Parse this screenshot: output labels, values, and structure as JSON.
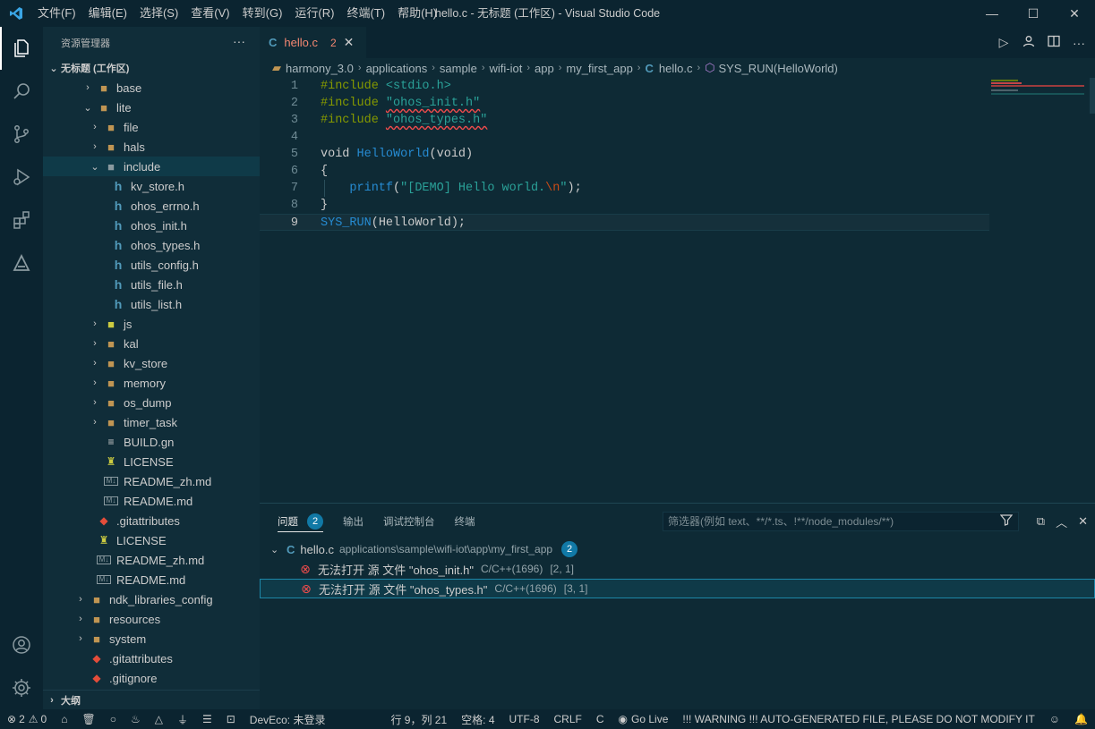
{
  "titlebar": {
    "menu": [
      "文件(F)",
      "编辑(E)",
      "选择(S)",
      "查看(V)",
      "转到(G)",
      "运行(R)",
      "终端(T)",
      "帮助(H)"
    ],
    "title": "hello.c - 无标题 (工作区) - Visual Studio Code",
    "minimize": "—",
    "maximize": "☐",
    "close": "✕"
  },
  "sidebar": {
    "title": "资源管理器",
    "more": "···",
    "workspace": "无标题 (工作区)",
    "outline": "大纲",
    "tree": [
      {
        "label": "base",
        "level": 1,
        "chev": "›",
        "icon": "folder-icon",
        "color": "#c09553"
      },
      {
        "label": "lite",
        "level": 1,
        "chev": "⌄",
        "icon": "folder-open-icon",
        "color": "#c09553"
      },
      {
        "label": "file",
        "level": 2,
        "chev": "›",
        "icon": "folder-icon",
        "color": "#c09553"
      },
      {
        "label": "hals",
        "level": 2,
        "chev": "›",
        "icon": "folder-icon",
        "color": "#c09553"
      },
      {
        "label": "include",
        "level": 2,
        "chev": "⌄",
        "icon": "folder-include-icon",
        "color": "#8a9aa0",
        "selected": true
      },
      {
        "label": "kv_store.h",
        "level": 3,
        "chev": "",
        "icon": "h-file-icon",
        "color": "#519aba"
      },
      {
        "label": "ohos_errno.h",
        "level": 3,
        "chev": "",
        "icon": "h-file-icon",
        "color": "#519aba"
      },
      {
        "label": "ohos_init.h",
        "level": 3,
        "chev": "",
        "icon": "h-file-icon",
        "color": "#519aba"
      },
      {
        "label": "ohos_types.h",
        "level": 3,
        "chev": "",
        "icon": "h-file-icon",
        "color": "#519aba"
      },
      {
        "label": "utils_config.h",
        "level": 3,
        "chev": "",
        "icon": "h-file-icon",
        "color": "#519aba"
      },
      {
        "label": "utils_file.h",
        "level": 3,
        "chev": "",
        "icon": "h-file-icon",
        "color": "#519aba"
      },
      {
        "label": "utils_list.h",
        "level": 3,
        "chev": "",
        "icon": "h-file-icon",
        "color": "#519aba"
      },
      {
        "label": "js",
        "level": 2,
        "chev": "›",
        "icon": "folder-js-icon",
        "color": "#cbcb41"
      },
      {
        "label": "kal",
        "level": 2,
        "chev": "›",
        "icon": "folder-icon",
        "color": "#c09553"
      },
      {
        "label": "kv_store",
        "level": 2,
        "chev": "›",
        "icon": "folder-icon",
        "color": "#c09553"
      },
      {
        "label": "memory",
        "level": 2,
        "chev": "›",
        "icon": "folder-icon",
        "color": "#c09553"
      },
      {
        "label": "os_dump",
        "level": 2,
        "chev": "›",
        "icon": "folder-icon",
        "color": "#c09553"
      },
      {
        "label": "timer_task",
        "level": 2,
        "chev": "›",
        "icon": "folder-icon",
        "color": "#c09553"
      },
      {
        "label": "BUILD.gn",
        "level": 2,
        "chev": "",
        "icon": "file-icon",
        "color": "#cccccc"
      },
      {
        "label": "LICENSE",
        "level": 2,
        "chev": "",
        "icon": "license-icon",
        "color": "#cbcb41"
      },
      {
        "label": "README_zh.md",
        "level": 2,
        "chev": "",
        "icon": "markdown-icon",
        "color": "#8a9aa0"
      },
      {
        "label": "README.md",
        "level": 2,
        "chev": "",
        "icon": "markdown-icon",
        "color": "#8a9aa0"
      },
      {
        "label": ".gitattributes",
        "level": 1,
        "chev": "",
        "icon": "git-icon",
        "color": "#e44d3a"
      },
      {
        "label": "LICENSE",
        "level": 1,
        "chev": "",
        "icon": "license-icon",
        "color": "#cbcb41"
      },
      {
        "label": "README_zh.md",
        "level": 1,
        "chev": "",
        "icon": "markdown-icon",
        "color": "#8a9aa0"
      },
      {
        "label": "README.md",
        "level": 1,
        "chev": "",
        "icon": "markdown-icon",
        "color": "#8a9aa0"
      },
      {
        "label": "ndk_libraries_config",
        "level": 0,
        "chev": "›",
        "icon": "folder-icon",
        "color": "#c09553"
      },
      {
        "label": "resources",
        "level": 0,
        "chev": "›",
        "icon": "folder-icon",
        "color": "#c09553"
      },
      {
        "label": "system",
        "level": 0,
        "chev": "›",
        "icon": "folder-icon",
        "color": "#c09553"
      },
      {
        "label": ".gitattributes",
        "level": 0,
        "chev": "",
        "icon": "git-icon",
        "color": "#e44d3a"
      },
      {
        "label": ".gitignore",
        "level": 0,
        "chev": "",
        "icon": "git-icon",
        "color": "#e44d3a"
      }
    ]
  },
  "editor": {
    "tab": {
      "label": "hello.c",
      "count": "2"
    },
    "breadcrumb": [
      "harmony_3.0",
      "applications",
      "sample",
      "wifi-iot",
      "app",
      "my_first_app",
      "hello.c",
      "SYS_RUN(HelloWorld)"
    ],
    "lines": [
      {
        "n": "1",
        "tokens": [
          {
            "t": "#include ",
            "c": "tk-inc"
          },
          {
            "t": "<stdio.h>",
            "c": "tk-str"
          }
        ]
      },
      {
        "n": "2",
        "tokens": [
          {
            "t": "#include ",
            "c": "tk-inc"
          },
          {
            "t": "\"ohos_init.h\"",
            "c": "tk-str squig"
          }
        ]
      },
      {
        "n": "3",
        "tokens": [
          {
            "t": "#include ",
            "c": "tk-inc"
          },
          {
            "t": "\"ohos_types.h\"",
            "c": "tk-str squig"
          }
        ]
      },
      {
        "n": "4",
        "tokens": []
      },
      {
        "n": "5",
        "tokens": [
          {
            "t": "void ",
            "c": "tk-kw"
          },
          {
            "t": "HelloWorld",
            "c": "tk-fn"
          },
          {
            "t": "(void)",
            "c": "tk-pl"
          }
        ]
      },
      {
        "n": "6",
        "tokens": [
          {
            "t": "{",
            "c": "tk-pl"
          }
        ]
      },
      {
        "n": "7",
        "tokens": [
          {
            "t": "    printf",
            "c": "tk-fn"
          },
          {
            "t": "(",
            "c": "tk-pl"
          },
          {
            "t": "\"[DEMO] Hello world.",
            "c": "tk-str"
          },
          {
            "t": "\\n",
            "c": "tk-esc"
          },
          {
            "t": "\"",
            "c": "tk-str"
          },
          {
            "t": ");",
            "c": "tk-pl"
          }
        ]
      },
      {
        "n": "8",
        "tokens": [
          {
            "t": "}",
            "c": "tk-pl"
          }
        ]
      },
      {
        "n": "9",
        "tokens": [
          {
            "t": "SYS_RUN",
            "c": "tk-fn"
          },
          {
            "t": "(HelloWorld);",
            "c": "tk-pl"
          }
        ],
        "current": true
      }
    ]
  },
  "panel": {
    "tabs": [
      "问题",
      "输出",
      "调试控制台",
      "终端"
    ],
    "problem_count": "2",
    "filter_placeholder": "筛选器(例如 text、**/*.ts、!**/node_modules/**)",
    "file": {
      "name": "hello.c",
      "path": "applications\\sample\\wifi-iot\\app\\my_first_app",
      "count": "2"
    },
    "problems": [
      {
        "msg": "无法打开 源 文件 \"ohos_init.h\"",
        "src": "C/C++(1696)",
        "pos": "[2, 1]"
      },
      {
        "msg": "无法打开 源 文件 \"ohos_types.h\"",
        "src": "C/C++(1696)",
        "pos": "[3, 1]"
      }
    ]
  },
  "status": {
    "errors": "2",
    "warnings": "0",
    "deveco": "DevEco: 未登录",
    "position": "行 9，列 21",
    "spaces": "空格: 4",
    "encoding": "UTF-8",
    "eol": "CRLF",
    "language": "C",
    "golive": "Go Live",
    "warning_text": "!!! WARNING !!! AUTO-GENERATED FILE, PLEASE DO NOT MODIFY IT"
  },
  "colors": {
    "accent": "#1179a6",
    "error": "#f14c4c",
    "background": "#0e2a35"
  }
}
